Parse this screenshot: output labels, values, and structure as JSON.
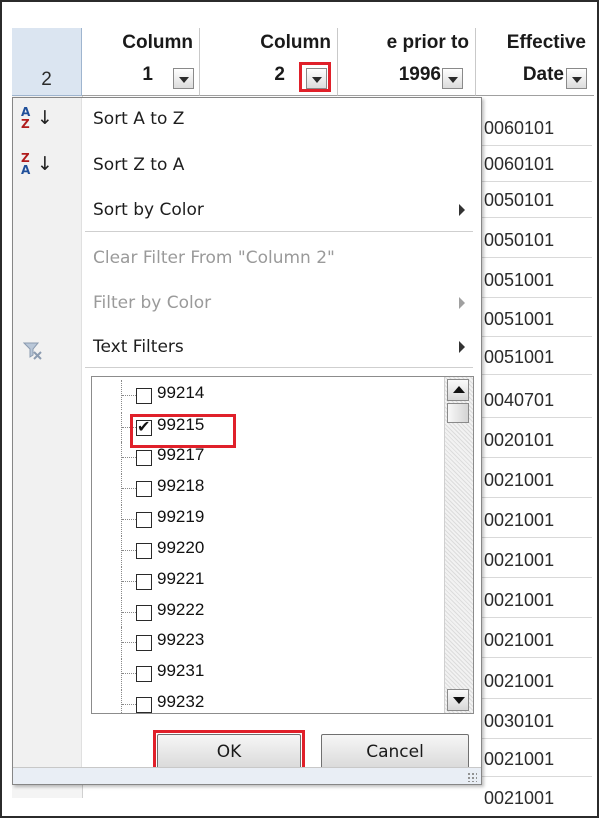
{
  "row_number": "2",
  "headers": [
    {
      "line1": "Column",
      "line2": "1"
    },
    {
      "line1": "Column",
      "line2": "2"
    },
    {
      "line1": "e prior to",
      "line2": "1996"
    },
    {
      "line1": "Effective",
      "line2": "Date"
    }
  ],
  "effective_dates": [
    "0060101",
    "0060101",
    "0050101",
    "0050101",
    "0051001",
    "0051001",
    "0051001",
    "0040701",
    "0020101",
    "0021001",
    "0021001",
    "0021001",
    "0021001",
    "0021001",
    "0021001",
    "0030101",
    "0021001",
    "0021001"
  ],
  "menu": {
    "sort_a_z": "Sort A to Z",
    "sort_z_a": "Sort Z to A",
    "sort_by_color": "Sort by Color",
    "clear_filter": "Clear Filter From \"Column 2\"",
    "filter_by_color": "Filter by Color",
    "text_filters": "Text Filters"
  },
  "filter_values": [
    {
      "label": "99214",
      "checked": false
    },
    {
      "label": "99215",
      "checked": true
    },
    {
      "label": "99217",
      "checked": false
    },
    {
      "label": "99218",
      "checked": false
    },
    {
      "label": "99219",
      "checked": false
    },
    {
      "label": "99220",
      "checked": false
    },
    {
      "label": "99221",
      "checked": false
    },
    {
      "label": "99222",
      "checked": false
    },
    {
      "label": "99223",
      "checked": false
    },
    {
      "label": "99231",
      "checked": false
    },
    {
      "label": "99232",
      "checked": false
    }
  ],
  "buttons": {
    "ok": "OK",
    "cancel": "Cancel"
  },
  "colors": {
    "highlight": "#e0202a",
    "row_header": "#dbe5f1"
  }
}
